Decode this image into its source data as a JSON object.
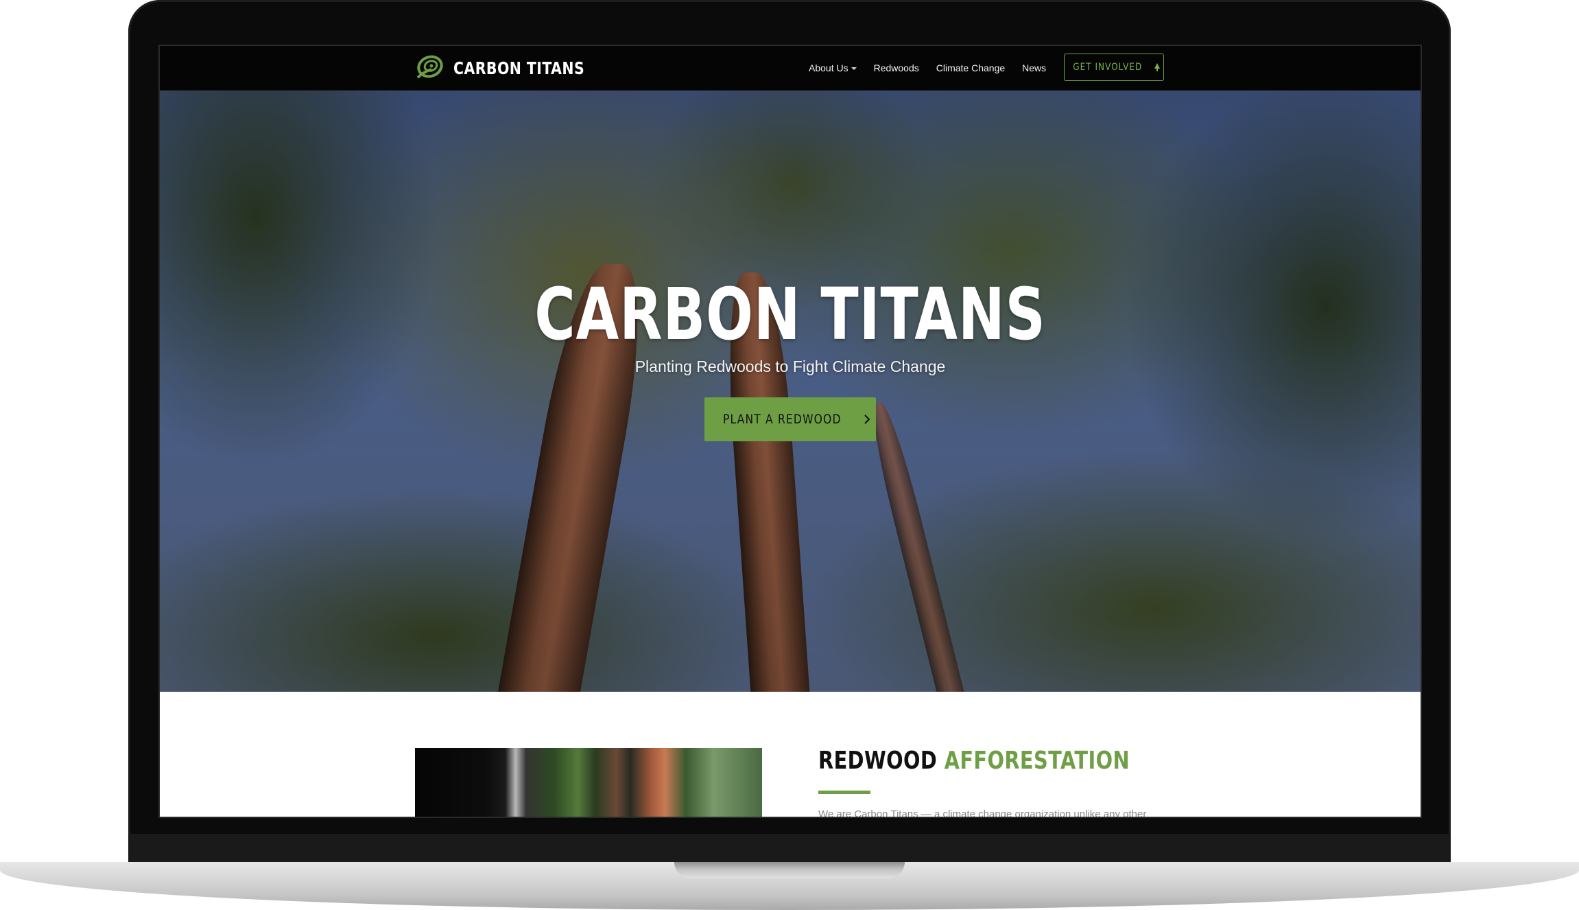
{
  "brand": {
    "name": "CARBON TITANS"
  },
  "nav": {
    "items": [
      {
        "label": "About Us",
        "has_dropdown": true
      },
      {
        "label": "Redwoods"
      },
      {
        "label": "Climate Change"
      },
      {
        "label": "News"
      }
    ],
    "cta_label": "GET INVOLVED",
    "cta_icon": "tree-icon"
  },
  "hero": {
    "title": "CARBON TITANS",
    "subtitle": "Planting Redwoods to Fight Climate Change",
    "button_label": "PLANT A REDWOOD",
    "button_icon": "chevron-right-icon"
  },
  "section": {
    "title_part1": "REDWOOD",
    "title_part2": "AFFORESTATION",
    "intro_text": "We are Carbon Titans — a climate change organization unlike any other"
  },
  "colors": {
    "accent": "#6e9f45",
    "nav_bg": "#050505",
    "text_dark": "#111111"
  }
}
